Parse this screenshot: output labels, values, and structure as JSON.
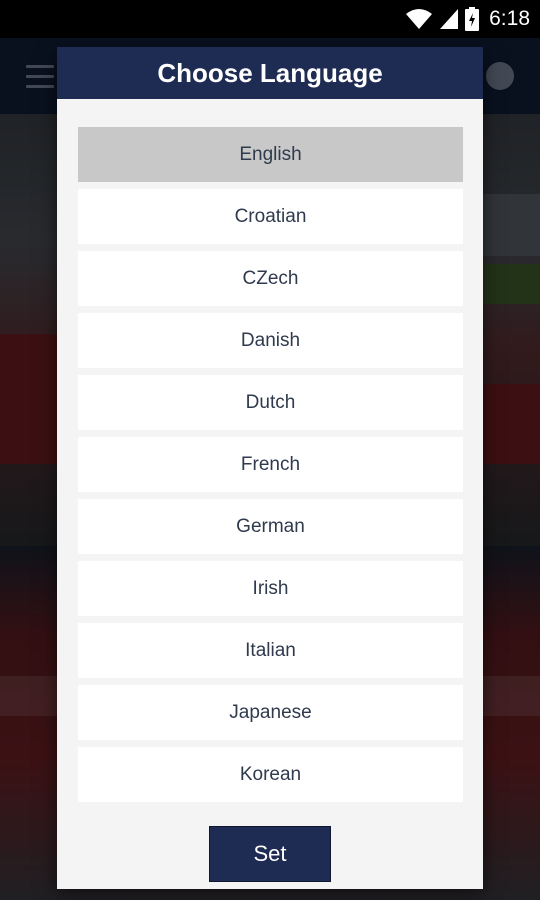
{
  "status_bar": {
    "time": "6:18",
    "icons": [
      "wifi-icon",
      "signal-icon",
      "battery-icon"
    ]
  },
  "dialog": {
    "title": "Choose Language",
    "selected": "English",
    "languages": [
      "English",
      "Croatian",
      "CZech",
      "Danish",
      "Dutch",
      "French",
      "German",
      "Irish",
      "Italian",
      "Japanese",
      "Korean"
    ],
    "set_label": "Set"
  },
  "colors": {
    "header": "#1e2b52",
    "selected_row": "#c8c8c8",
    "row": "#ffffff",
    "dialog_bg": "#f4f4f4",
    "text": "#2f3a4d"
  }
}
